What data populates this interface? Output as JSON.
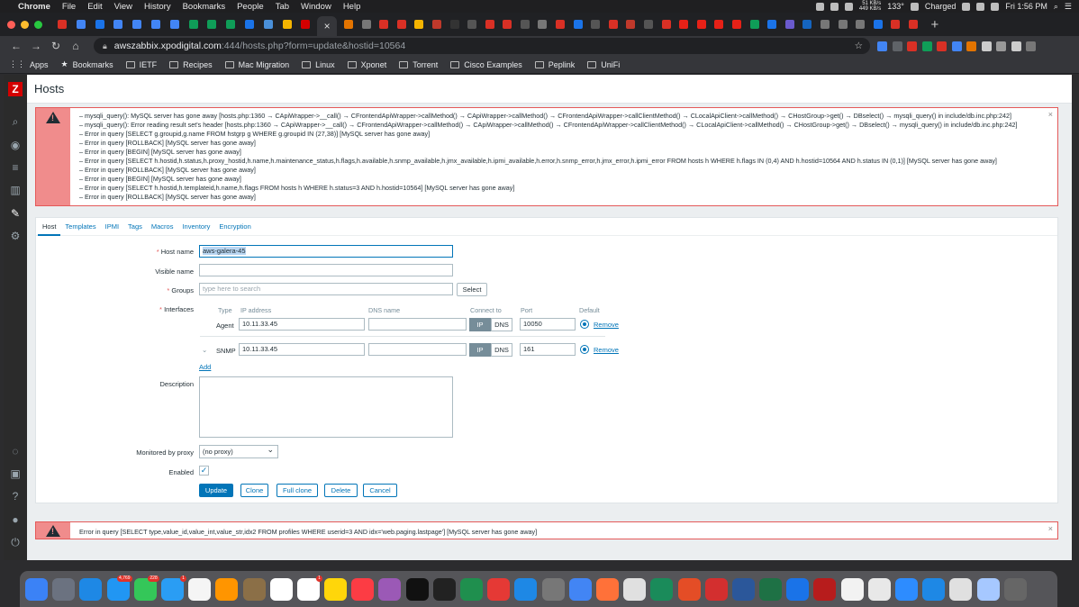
{
  "menubar": {
    "app": "Chrome",
    "items": [
      "File",
      "Edit",
      "View",
      "History",
      "Bookmarks",
      "People",
      "Tab",
      "Window",
      "Help"
    ],
    "net_up": "51 KB/s",
    "net_down": "449 KB/s",
    "temp": "133°",
    "battery": "Charged",
    "clock": "Fri 1:56 PM"
  },
  "browser": {
    "url_host": "awszabbix.xpodigital.com",
    "url_path": ":444/hosts.php?form=update&hostid=10564",
    "bookmarks": [
      "Apps",
      "Bookmarks",
      "IETF",
      "Recipes",
      "Mac Migration",
      "Linux",
      "Xponet",
      "Torrent",
      "Cisco Examples",
      "Peplink",
      "UniFi"
    ]
  },
  "page": {
    "title": "Hosts"
  },
  "errors_top": [
    "mysqli_query(): MySQL server has gone away [hosts.php:1360 → CApiWrapper->__call() → CFrontendApiWrapper->callMethod() → CApiWrapper->callMethod() → CFrontendApiWrapper->callClientMethod() → CLocalApiClient->callMethod() → CHostGroup->get() → DBselect() → mysqli_query() in include/db.inc.php:242]",
    "mysqli_query(): Error reading result set's header [hosts.php:1360 → CApiWrapper->__call() → CFrontendApiWrapper->callMethod() → CApiWrapper->callMethod() → CFrontendApiWrapper->callClientMethod() → CLocalApiClient->callMethod() → CHostGroup->get() → DBselect() → mysqli_query() in include/db.inc.php:242]",
    "Error in query [SELECT g.groupid,g.name FROM hstgrp g WHERE g.groupid IN (27,38)] [MySQL server has gone away]",
    "Error in query [ROLLBACK] [MySQL server has gone away]",
    "Error in query [BEGIN] [MySQL server has gone away]",
    "Error in query [SELECT h.hostid,h.status,h.proxy_hostid,h.name,h.maintenance_status,h.flags,h.available,h.snmp_available,h.jmx_available,h.ipmi_available,h.error,h.snmp_error,h.jmx_error,h.ipmi_error FROM hosts h WHERE h.flags IN (0,4) AND h.hostid=10564 AND h.status IN (0,1)] [MySQL server has gone away]",
    "Error in query [ROLLBACK] [MySQL server has gone away]",
    "Error in query [BEGIN] [MySQL server has gone away]",
    "Error in query [SELECT h.hostid,h.templateid,h.name,h.flags FROM hosts h WHERE h.status=3 AND h.hostid=10564] [MySQL server has gone away]",
    "Error in query [ROLLBACK] [MySQL server has gone away]"
  ],
  "error_bottom": "Error in query [SELECT type,value_id,value_int,value_str,idx2 FROM profiles WHERE userid=3 AND idx='web.paging.lastpage'] [MySQL server has gone away]",
  "close_glyph": "×",
  "tabs": [
    "Host",
    "Templates",
    "IPMI",
    "Tags",
    "Macros",
    "Inventory",
    "Encryption"
  ],
  "form": {
    "host_name_label": "Host name",
    "host_name_value": "aws-galera-45",
    "visible_name_label": "Visible name",
    "visible_name_value": "",
    "groups_label": "Groups",
    "groups_placeholder": "type here to search",
    "select_button": "Select",
    "interfaces_label": "Interfaces",
    "columns": {
      "type": "Type",
      "ip": "IP address",
      "dns": "DNS name",
      "connect": "Connect to",
      "port": "Port",
      "default": "Default"
    },
    "interfaces": [
      {
        "type": "Agent",
        "ip": "10.11.33.45",
        "dns": "",
        "connect_ip": "IP",
        "connect_dns": "DNS",
        "port": "10050",
        "remove": "Remove"
      },
      {
        "type": "SNMP",
        "ip": "10.11.33.45",
        "dns": "",
        "connect_ip": "IP",
        "connect_dns": "DNS",
        "port": "161",
        "remove": "Remove"
      }
    ],
    "add_link": "Add",
    "description_label": "Description",
    "description_value": "",
    "proxy_label": "Monitored by proxy",
    "proxy_value": "(no proxy)",
    "enabled_label": "Enabled",
    "enabled": true,
    "buttons": {
      "update": "Update",
      "clone": "Clone",
      "full_clone": "Full clone",
      "delete": "Delete",
      "cancel": "Cancel"
    }
  },
  "dock_badges": [
    "4,769",
    "228",
    "1",
    "1"
  ]
}
